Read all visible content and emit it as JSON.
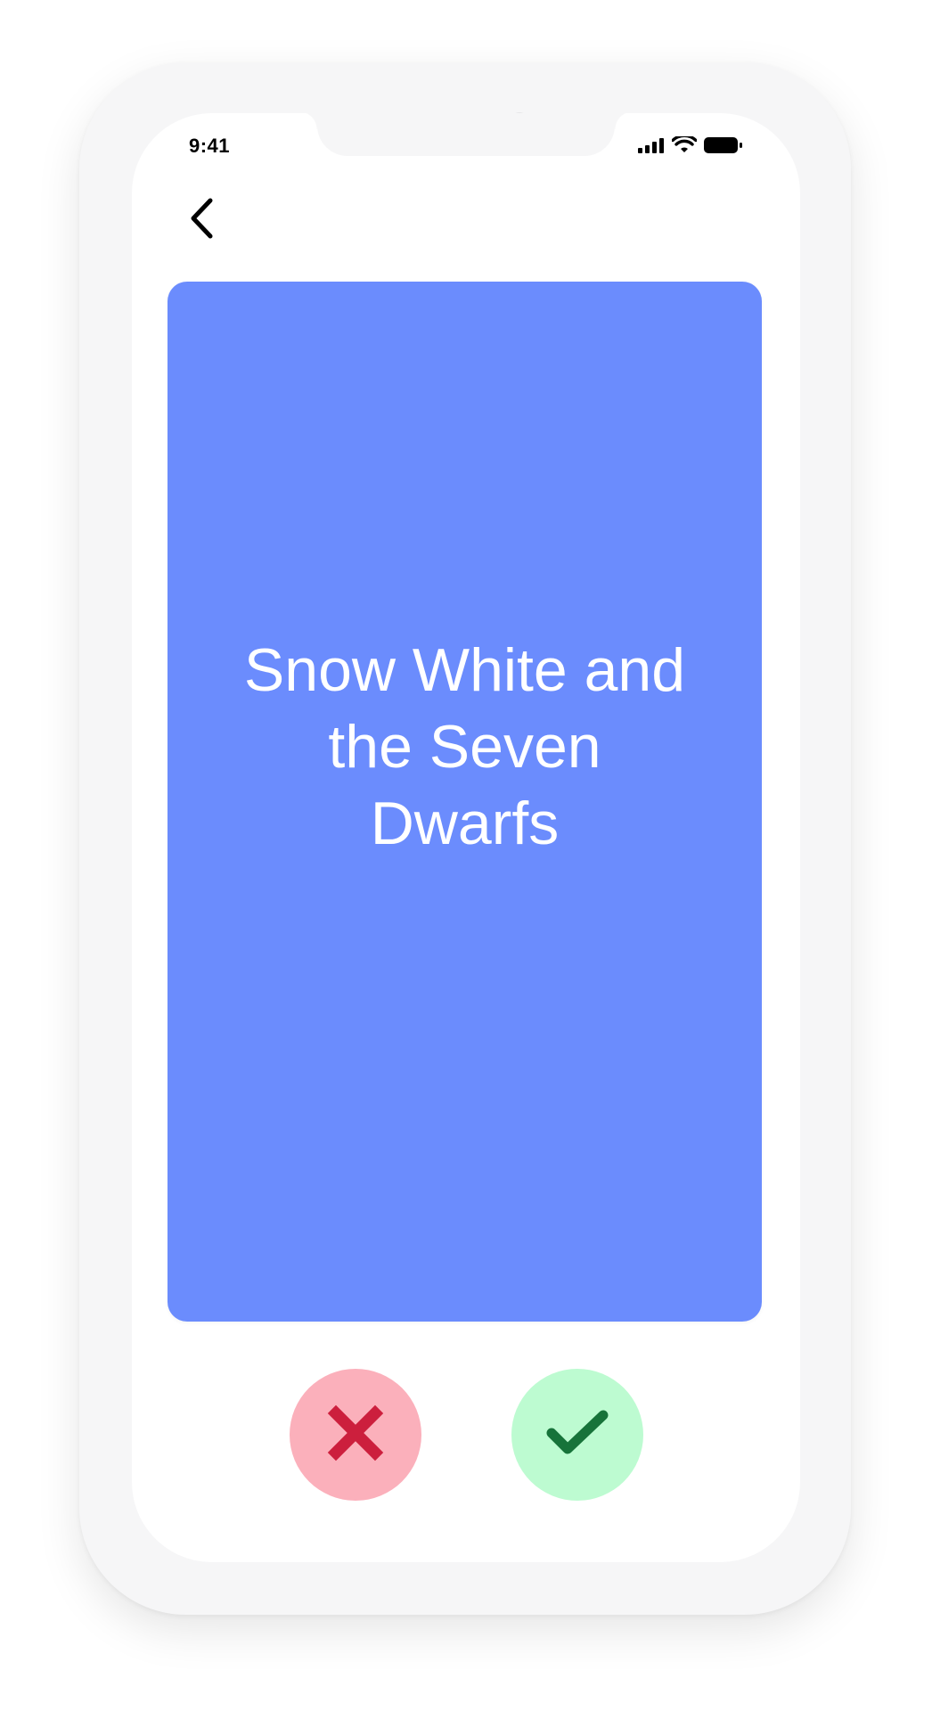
{
  "status_bar": {
    "time": "9:41",
    "icons": [
      "cellular-signal-icon",
      "wifi-icon",
      "battery-icon"
    ]
  },
  "nav": {
    "back_icon": "chevron-left-icon"
  },
  "card": {
    "text": "Snow White and the Seven Dwarfs",
    "background_color": "#6b8cfd",
    "text_color": "#ffffff"
  },
  "actions": {
    "reject": {
      "icon": "close-icon",
      "background_color": "#fbb0bb",
      "icon_color": "#cc1f3d"
    },
    "accept": {
      "icon": "checkmark-icon",
      "background_color": "#bdfbd1",
      "icon_color": "#17733a"
    }
  }
}
